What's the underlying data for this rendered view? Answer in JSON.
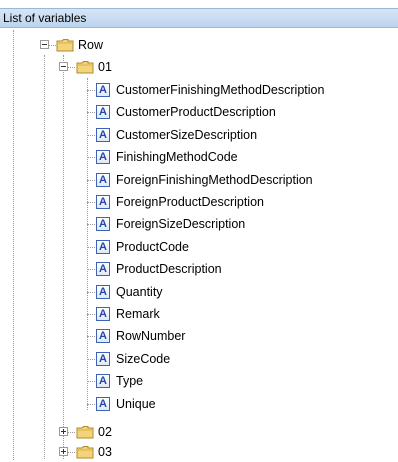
{
  "panel": {
    "title": "List of variables"
  },
  "tree": {
    "row_label": "Row",
    "group_01": "01",
    "group_02": "02",
    "group_03": "03",
    "variables": [
      "CustomerFinishingMethodDescription",
      "CustomerProductDescription",
      "CustomerSizeDescription",
      "FinishingMethodCode",
      "ForeignFinishingMethodDescription",
      "ForeignProductDescription",
      "ForeignSizeDescription",
      "ProductCode",
      "ProductDescription",
      "Quantity",
      "Remark",
      "RowNumber",
      "SizeCode",
      "Type",
      "Unique"
    ],
    "variable_icon": "variable-a-icon",
    "folder_icon": "folder-icon"
  }
}
